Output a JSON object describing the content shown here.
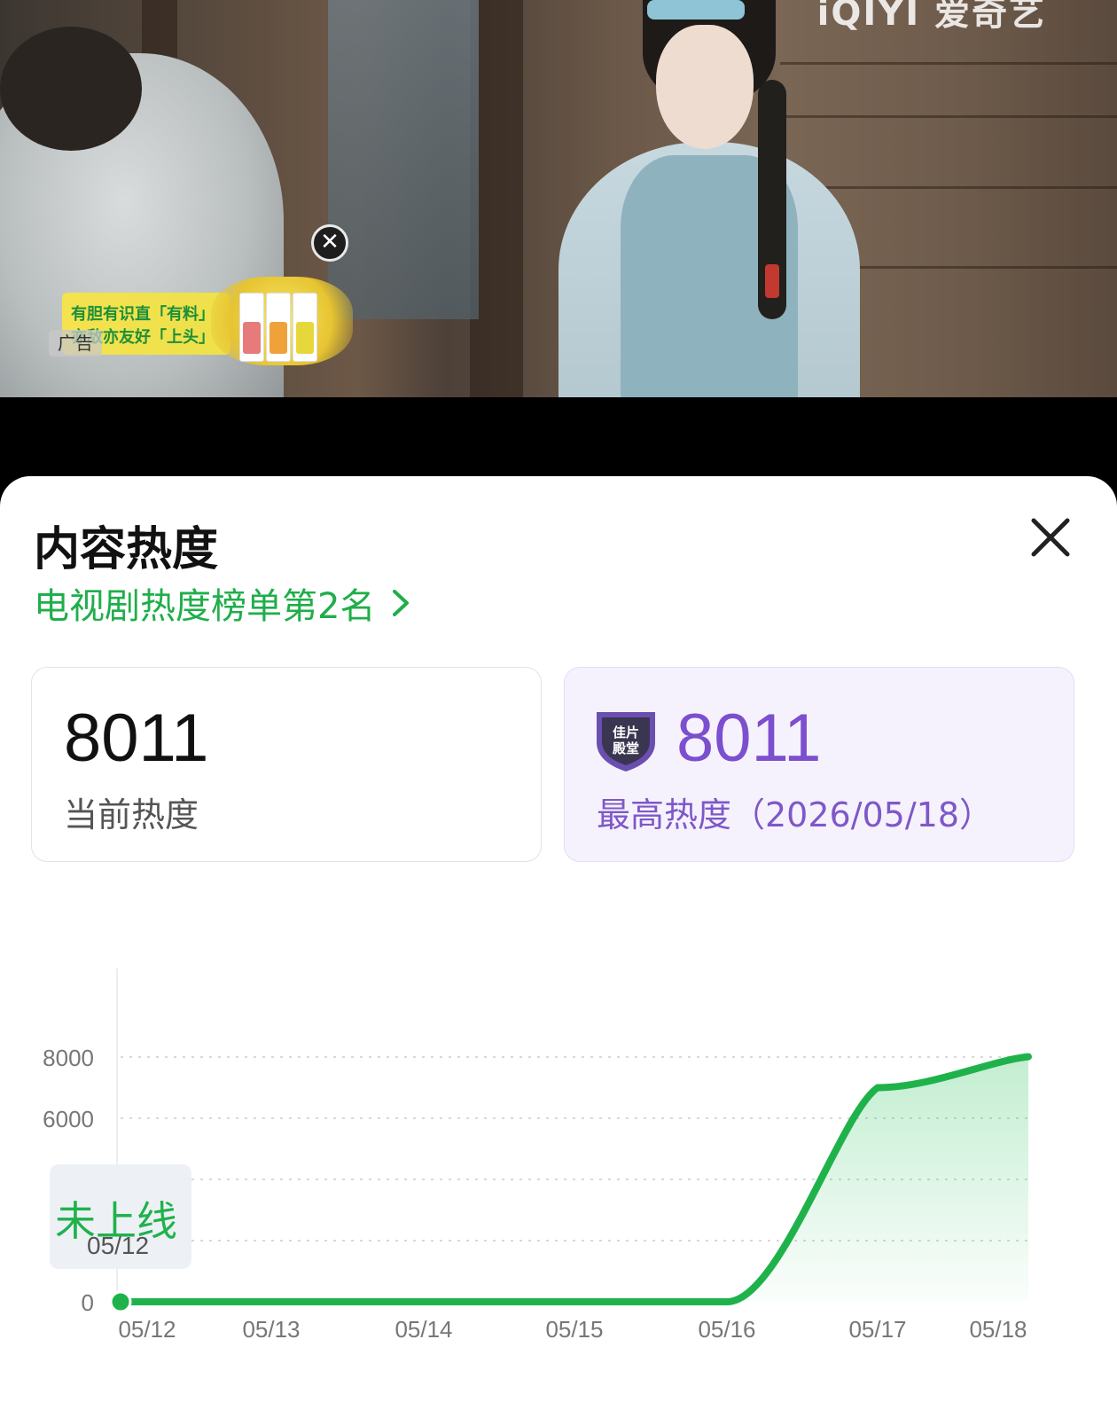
{
  "video": {
    "watermark": "iQIYI 爱奇艺",
    "ad": {
      "line1": "有胆有识直「有料」",
      "line2": "亦敌亦友好「上头」",
      "label": "广告",
      "close_icon": "close-circle-icon"
    }
  },
  "panel": {
    "title": "内容热度",
    "close_icon": "close-icon",
    "rank_text": "电视剧热度榜单第2名",
    "rank_icon": "chevron-right-icon",
    "colors": {
      "accent_green": "#1fae4a",
      "purple": "#7b4fce"
    }
  },
  "stats": {
    "current": {
      "value": "8011",
      "label": "当前热度"
    },
    "peak": {
      "value": "8011",
      "label": "最高热度（2026/05/18）",
      "badge_text": "佳片殿堂",
      "badge_icon": "hall-of-fame-shield-icon"
    }
  },
  "tooltip": {
    "state": "未上线",
    "date": "05/12"
  },
  "chart_data": {
    "type": "area",
    "x": [
      "05/12",
      "05/13",
      "05/14",
      "05/15",
      "05/16",
      "05/17",
      "05/18"
    ],
    "values": [
      0,
      0,
      0,
      0,
      0,
      7000,
      8011
    ],
    "y_ticks": [
      0,
      2000,
      4000,
      6000,
      8000
    ],
    "y_tick_labels": [
      "0",
      "",
      "",
      "6000",
      "8000"
    ],
    "ylim": [
      0,
      8000
    ],
    "grid": true,
    "color": "#1fb24b"
  }
}
